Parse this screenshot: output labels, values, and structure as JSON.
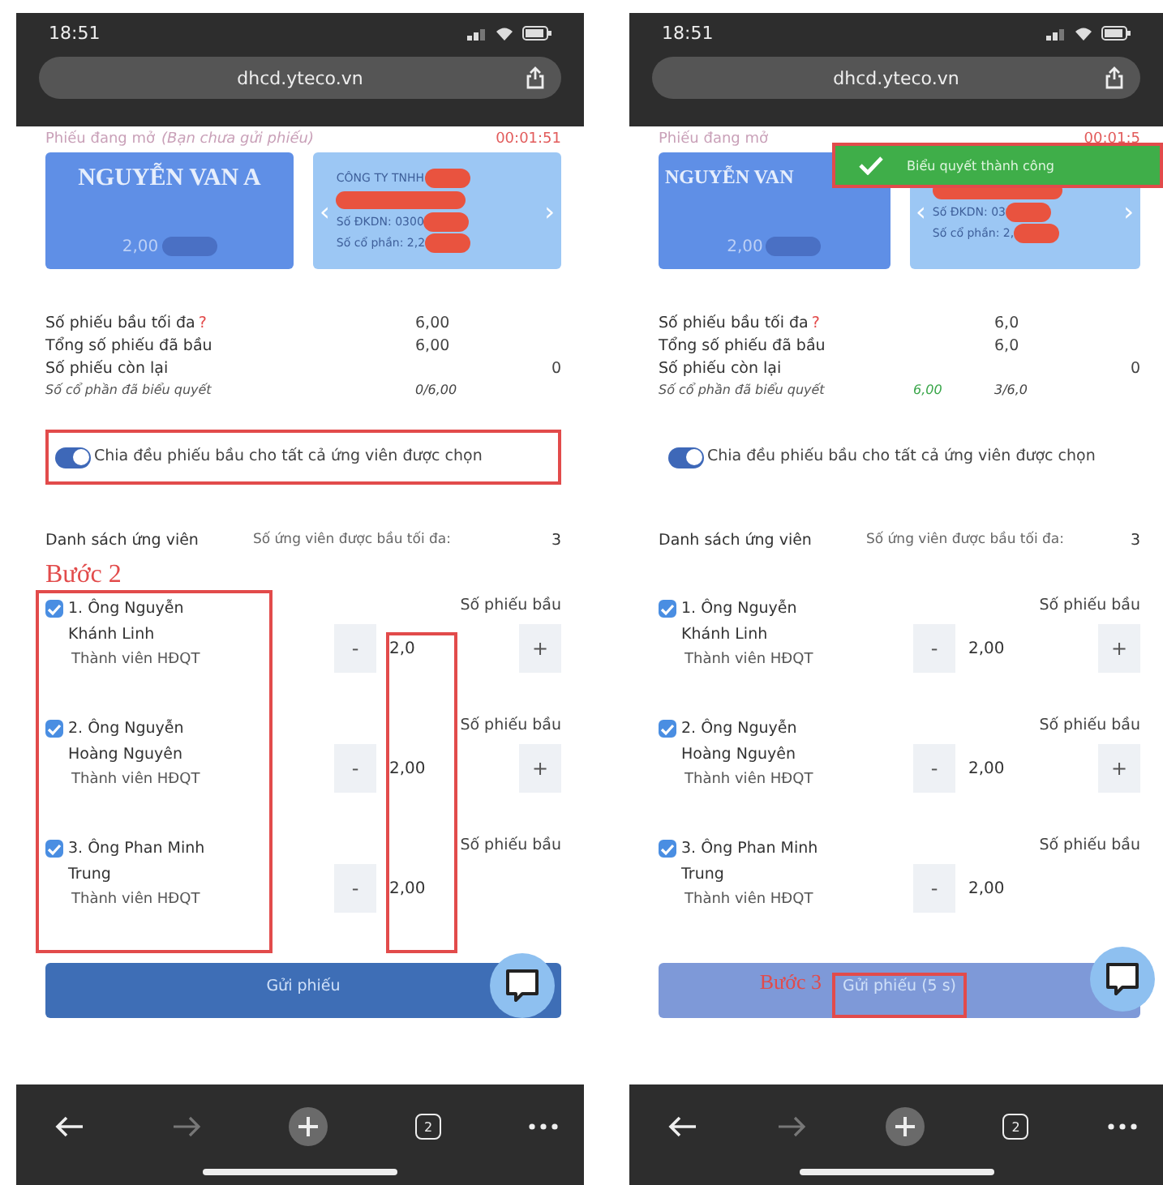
{
  "screens": [
    {
      "status_bar": {
        "time": "18:51"
      },
      "address_bar": {
        "url": "dhcd.yteco.vn"
      },
      "ballot_status": {
        "label": "Phiếu đang mở",
        "note": "(Bạn chưa gửi phiếu)",
        "timer": "00:01:51"
      },
      "voter_card": {
        "name": "NGUYỄN VAN A",
        "shares": "2,00"
      },
      "company_card": {
        "prev": "‹",
        "lines": [
          "CÔNG TY TNHH",
          "Số ĐKDN: 0300",
          "Số cổ phần: 2,2"
        ],
        "next": "›"
      },
      "stats": [
        {
          "kind": "required",
          "label": "Số phiếu bầu tối đa",
          "mark": "?",
          "value": "6,00"
        },
        {
          "kind": "plain",
          "label": "Tổng số phiếu đã bầu",
          "value": "6,00"
        },
        {
          "kind": "plain",
          "label": "Số phiếu còn lại",
          "value": "0"
        },
        {
          "kind": "italic",
          "label": "Số cổ phần đã biểu quyết",
          "value": "0/6,00"
        }
      ],
      "toggle": {
        "label": "Chia đều phiếu bầu cho tất cả ứng viên được chọn",
        "on": true,
        "highlighted": true
      },
      "candidate_list": {
        "title": "Danh sách ứng viên",
        "max_label": "Số ứng viên được bầu tối đa:",
        "max_value": "3"
      },
      "step_label": "Bước 2",
      "highlight_candidates": true,
      "highlight_values": true,
      "candidates": [
        {
          "name": "1. Ông Nguyễn Khánh Linh",
          "role": "Thành viên HĐQT",
          "checked": true,
          "votes_label": "Số phiếu bầu",
          "minus": "-",
          "value": "2,0",
          "plus": "+"
        },
        {
          "name": "2. Ông Nguyễn Hoàng Nguyên",
          "role": "Thành viên HĐQT",
          "checked": true,
          "votes_label": "Số phiếu bầu",
          "minus": "-",
          "value": "2,00",
          "plus": "+"
        },
        {
          "name": "3. Ông Phan Minh Trung",
          "role": "Thành viên HĐQT",
          "checked": true,
          "votes_label": "Số phiếu bầu",
          "minus": "-",
          "value": "2,00"
        }
      ],
      "submit": {
        "label": "Gửi phiếu",
        "disabled": false,
        "highlighted": false
      },
      "browser_bar": {
        "tab_count": "2"
      }
    },
    {
      "status_bar": {
        "time": "18:51"
      },
      "address_bar": {
        "url": "dhcd.yteco.vn"
      },
      "ballot_status": {
        "label": "Phiếu đang mở",
        "timer": "00:01:5"
      },
      "toast": {
        "text": "Biểu quyết thành công",
        "highlighted": true
      },
      "voter_card": {
        "name": "NGUYỄN VAN",
        "shares": "2,00"
      },
      "company_card": {
        "prev": "‹",
        "lines": [
          "Số ĐKDN: 03",
          "Số cổ phần: 2,"
        ],
        "next": "›"
      },
      "stats": [
        {
          "kind": "required",
          "label": "Số phiếu bầu tối đa",
          "mark": "?",
          "value": "6,0"
        },
        {
          "kind": "plain",
          "label": "Tổng số phiếu đã bầu",
          "value": "6,0"
        },
        {
          "kind": "plain",
          "label": "Số phiếu còn lại",
          "value": "0"
        },
        {
          "kind": "italic",
          "label": "Số cổ phần đã biểu quyết",
          "voted": "6,00",
          "value": "3/6,0"
        }
      ],
      "toggle": {
        "label": "Chia đều phiếu bầu cho tất cả ứng viên được chọn",
        "on": true,
        "highlighted": false
      },
      "candidate_list": {
        "title": "Danh sách ứng viên",
        "max_label": "Số ứng viên được bầu tối đa:",
        "max_value": "3"
      },
      "highlight_candidates": false,
      "highlight_values": false,
      "candidates": [
        {
          "name": "1. Ông Nguyễn Khánh Linh",
          "role": "Thành viên HĐQT",
          "checked": true,
          "votes_label": "Số phiếu bầu",
          "minus": "-",
          "value": "2,00",
          "plus": "+"
        },
        {
          "name": "2. Ông Nguyễn Hoàng Nguyên",
          "role": "Thành viên HĐQT",
          "checked": true,
          "votes_label": "Số phiếu bầu",
          "minus": "-",
          "value": "2,00",
          "plus": "+"
        },
        {
          "name": "3. Ông Phan Minh Trung",
          "role": "Thành viên HĐQT",
          "checked": true,
          "votes_label": "Số phiếu bầu",
          "minus": "-",
          "value": "2,00"
        }
      ],
      "submit": {
        "label": "Gửi phiếu (5 s)",
        "disabled": true,
        "highlighted": true,
        "step_label": "Bước 3"
      },
      "browser_bar": {
        "tab_count": "2"
      }
    }
  ]
}
